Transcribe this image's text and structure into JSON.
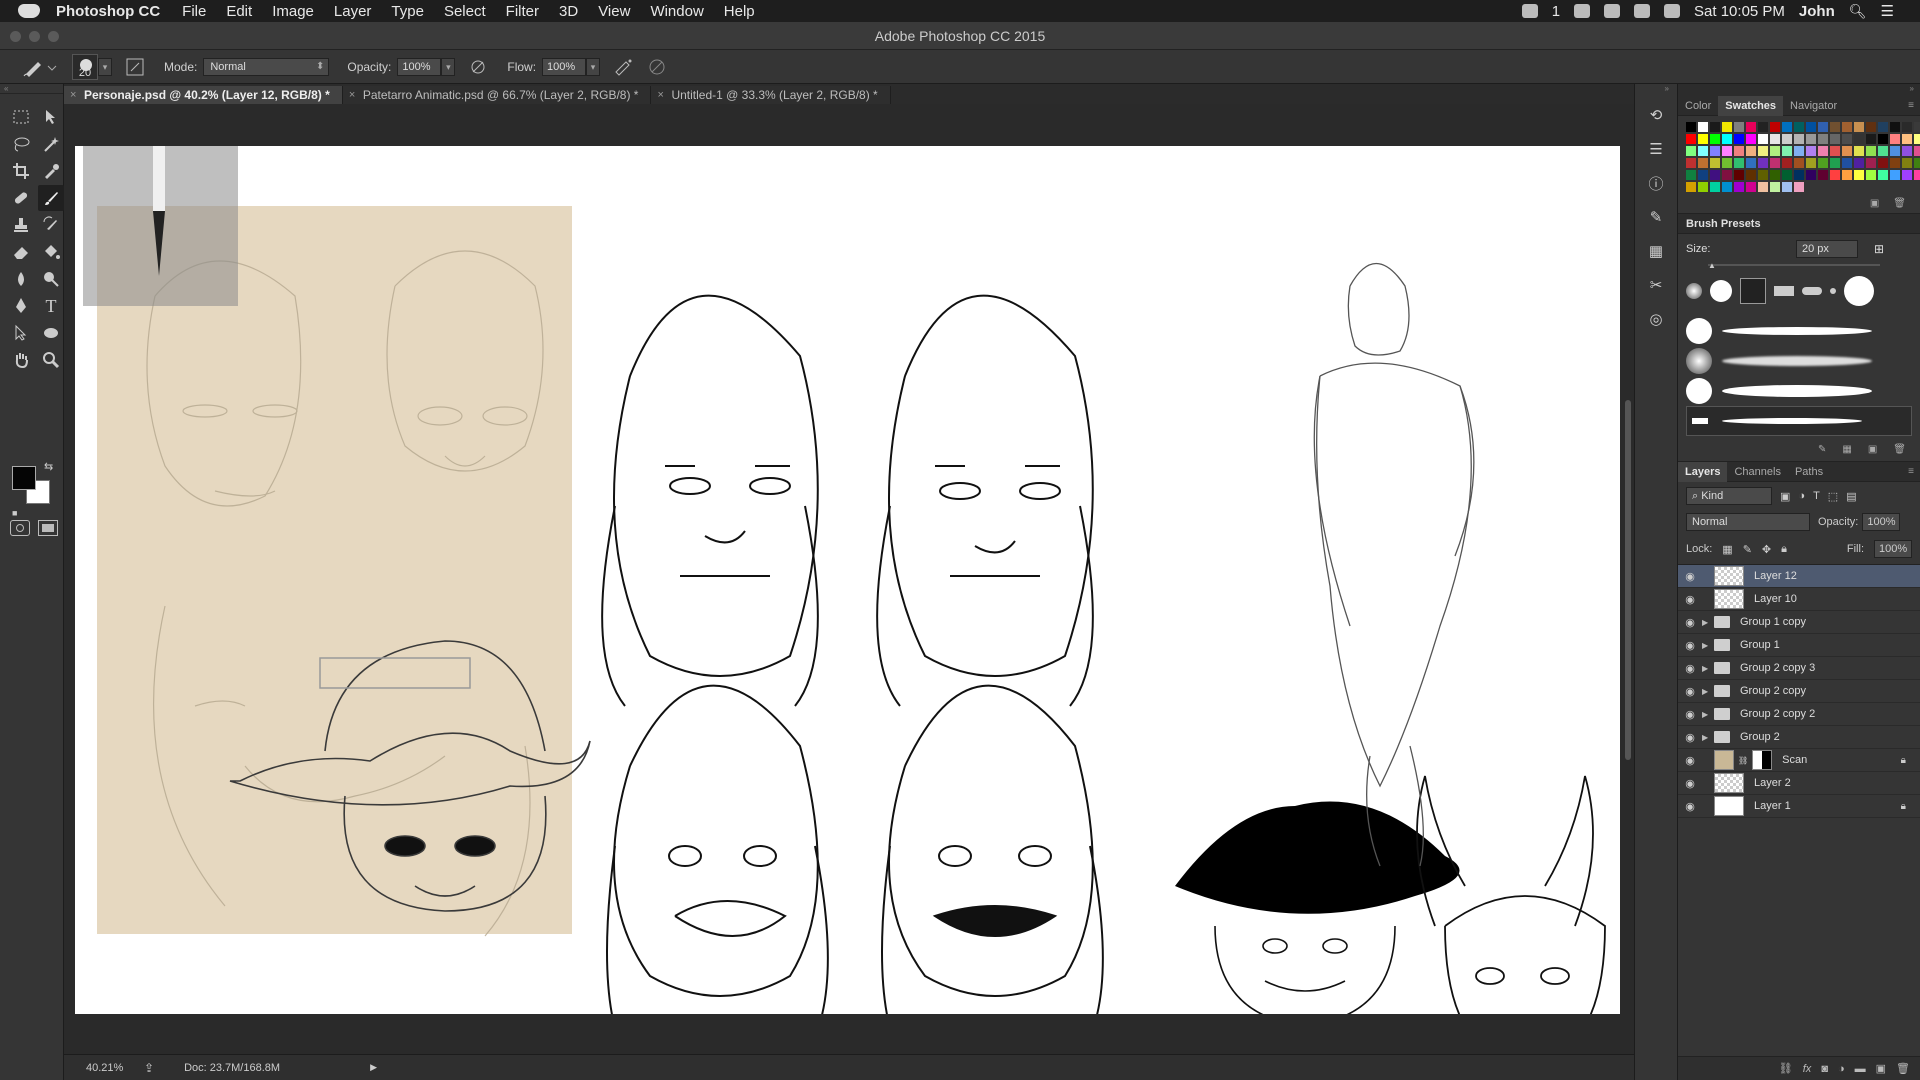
{
  "menubar": {
    "app": "Photoshop CC",
    "items": [
      "File",
      "Edit",
      "Image",
      "Layer",
      "Type",
      "Select",
      "Filter",
      "3D",
      "View",
      "Window",
      "Help"
    ],
    "clock": "Sat 10:05 PM",
    "user": "John",
    "badge": "1"
  },
  "window": {
    "title": "Adobe Photoshop CC 2015"
  },
  "options": {
    "brush_size": "20",
    "mode_label": "Mode:",
    "mode_value": "Normal",
    "opacity_label": "Opacity:",
    "opacity_value": "100%",
    "flow_label": "Flow:",
    "flow_value": "100%"
  },
  "tabs": [
    {
      "label": "Personaje.psd @ 40.2% (Layer 12, RGB/8) *"
    },
    {
      "label": "Patetarro Animatic.psd @ 66.7% (Layer 2, RGB/8) *"
    },
    {
      "label": "Untitled-1 @ 33.3% (Layer 2, RGB/8) *"
    }
  ],
  "status": {
    "zoom": "40.21%",
    "doc": "Doc: 23.7M/168.8M"
  },
  "swatch_panel": {
    "tabs": [
      "Color",
      "Swatches",
      "Navigator"
    ],
    "colors": [
      "#000000",
      "#ffffff",
      "#1a1a1a",
      "#f2e600",
      "#7f7f7f",
      "#e8005a",
      "#222222",
      "#c00000",
      "#0070c0",
      "#006060",
      "#0050a0",
      "#3060b0",
      "#705030",
      "#a06030",
      "#c89050",
      "#603010",
      "#204060",
      "#101010",
      "#2a2a2a",
      "#3a3a3a",
      "#ff0000",
      "#ffff00",
      "#00ff00",
      "#00ffff",
      "#0000ff",
      "#ff00ff",
      "#ffffff",
      "#e6e6e6",
      "#cccccc",
      "#b3b3b3",
      "#999999",
      "#808080",
      "#666666",
      "#4d4d4d",
      "#333333",
      "#1a1a1a",
      "#000000",
      "#ff8080",
      "#ffc080",
      "#ffff80",
      "#80ff80",
      "#80ffff",
      "#8080ff",
      "#ff80ff",
      "#f08080",
      "#f0b080",
      "#f0f080",
      "#b0f080",
      "#80f0b0",
      "#80b0f0",
      "#b080f0",
      "#f080b0",
      "#e05050",
      "#e09050",
      "#e0e050",
      "#90e050",
      "#50e090",
      "#5090e0",
      "#9050e0",
      "#e05090",
      "#c03030",
      "#c07030",
      "#c0c030",
      "#70c030",
      "#30c070",
      "#3070c0",
      "#7030c0",
      "#c03070",
      "#a02020",
      "#a05020",
      "#a0a020",
      "#50a020",
      "#20a050",
      "#2050a0",
      "#5020a0",
      "#a02050",
      "#801010",
      "#804010",
      "#808010",
      "#408010",
      "#108040",
      "#104080",
      "#401080",
      "#801040",
      "#600000",
      "#603000",
      "#606000",
      "#306000",
      "#006030",
      "#003060",
      "#300060",
      "#600030",
      "#ff4040",
      "#ffa040",
      "#ffff40",
      "#a0ff40",
      "#40ffa0",
      "#40a0ff",
      "#a040ff",
      "#ff40a0",
      "#d4a000",
      "#90d000",
      "#00d0a0",
      "#0090d0",
      "#a000d0",
      "#d00090",
      "#f0c0a0",
      "#c0f0a0",
      "#a0c0f0",
      "#f0a0c0"
    ]
  },
  "brush_presets": {
    "title": "Brush Presets",
    "size_label": "Size:",
    "size_value": "20 px"
  },
  "layers_panel": {
    "tabs": [
      "Layers",
      "Channels",
      "Paths"
    ],
    "filter": "Kind",
    "blend": "Normal",
    "opacity_label": "Opacity:",
    "opacity_value": "100%",
    "lock_label": "Lock:",
    "fill_label": "Fill:",
    "fill_value": "100%",
    "layers": [
      {
        "name": "Layer 12",
        "kind": "layer",
        "selected": true,
        "locked": false
      },
      {
        "name": "Layer 10",
        "kind": "layer",
        "selected": false,
        "locked": false
      },
      {
        "name": "Group 1 copy",
        "kind": "group",
        "selected": false,
        "locked": false
      },
      {
        "name": "Group 1",
        "kind": "group",
        "selected": false,
        "locked": false
      },
      {
        "name": "Group 2 copy 3",
        "kind": "group",
        "selected": false,
        "locked": false
      },
      {
        "name": "Group 2 copy",
        "kind": "group",
        "selected": false,
        "locked": false
      },
      {
        "name": "Group 2 copy 2",
        "kind": "group",
        "selected": false,
        "locked": false
      },
      {
        "name": "Group 2",
        "kind": "group",
        "selected": false,
        "locked": false
      },
      {
        "name": "Scan",
        "kind": "scan",
        "selected": false,
        "locked": true
      },
      {
        "name": "Layer 2",
        "kind": "layer",
        "selected": false,
        "locked": false
      },
      {
        "name": "Layer 1",
        "kind": "white",
        "selected": false,
        "locked": true
      }
    ]
  }
}
